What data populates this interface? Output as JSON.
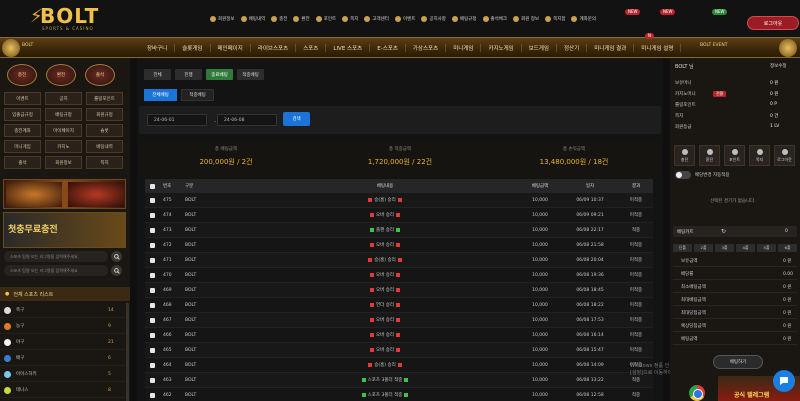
{
  "header": {
    "logo_text": "BOLT",
    "logo_sub": "SPORTS & CASINO",
    "menu": [
      {
        "icon": "user-icon",
        "label": "회원정보"
      },
      {
        "icon": "coin-icon",
        "label": "배팅내역"
      },
      {
        "icon": "deposit-icon",
        "label": "충전"
      },
      {
        "icon": "withdraw-icon",
        "label": "환전"
      },
      {
        "icon": "point-icon",
        "label": "포인트"
      },
      {
        "icon": "mail-icon",
        "label": "쪽지"
      },
      {
        "icon": "notice-icon",
        "label": "고객센터"
      },
      {
        "icon": "event-icon",
        "label": "이벤트"
      },
      {
        "icon": "rule-icon",
        "label": "공지사항"
      },
      {
        "icon": "bet-rule-icon",
        "label": "배팅규정"
      },
      {
        "icon": "attend-icon",
        "label": "출석체크"
      },
      {
        "icon": "gift-icon",
        "label": "회원 정보"
      },
      {
        "icon": "msg-icon",
        "label": "쪽지함"
      },
      {
        "icon": "account-icon",
        "label": "계좌문의"
      }
    ],
    "badges": [
      "NEW",
      "NEW",
      "NEW"
    ],
    "logout_label": "로그아웃"
  },
  "nav": {
    "left_tag": "BOLT",
    "right_tag": "BOLT EVENT",
    "items": [
      "장바구니",
      "슬롯게임",
      "메인페이지",
      "라이브스포츠",
      "스포츠",
      "LIVE 스포츠",
      "E-스포츠",
      "가상스포츠",
      "미니게임",
      "카지노게임",
      "보드게임",
      "정산기",
      "미니게임 결과",
      "미니게임 설명"
    ],
    "new_badge": "N"
  },
  "left": {
    "circles": [
      "충전",
      "환전",
      "출석"
    ],
    "grid": [
      "이벤트",
      "공지",
      "롤링포인트",
      "입출금규정",
      "배팅규정",
      "회원규정",
      "충전계좌",
      "마이페이지",
      "슬롯",
      "미니게임",
      "카지노",
      "베팅내역",
      "출석",
      "회원정보",
      "쪽지"
    ],
    "promo_text": "첫충무료충전",
    "inputs": [
      "스포츠 팀명 또는 리그명을 입력해주세요",
      "스포츠 팀명 또는 리그명을 입력해주세요"
    ],
    "sports_title": "전체 스포츠 리스트",
    "sports": [
      {
        "name": "축구",
        "count": "14",
        "color": "#dcdcdc"
      },
      {
        "name": "농구",
        "count": "9",
        "color": "#e07a2a"
      },
      {
        "name": "야구",
        "count": "21",
        "color": "#f2f2f2"
      },
      {
        "name": "배구",
        "count": "6",
        "color": "#3b7bd8"
      },
      {
        "name": "아이스하키",
        "count": "5",
        "color": "#7ac6f0"
      },
      {
        "name": "테니스",
        "count": "8",
        "color": "#c6dc3a"
      }
    ]
  },
  "main": {
    "tabs": [
      {
        "label": "전체",
        "active": false
      },
      {
        "label": "진행",
        "active": false
      },
      {
        "label": "종료베팅",
        "active": true
      },
      {
        "label": "적중베팅",
        "active": false
      }
    ],
    "subtabs": [
      {
        "label": "전체베팅",
        "active": true
      },
      {
        "label": "적중베팅",
        "active": false
      }
    ],
    "date_from": "24-06-01",
    "date_to": "24-06-08",
    "search_label": "검색",
    "summary": [
      {
        "label": "총 베팅금액",
        "value": "200,000원 / 2건"
      },
      {
        "label": "총 적중금액",
        "value": "1,720,000원 / 22건"
      },
      {
        "label": "총 손익금액",
        "value": "13,480,000원 / 18건"
      }
    ],
    "columns": [
      "번호",
      "구분",
      "베팅내용",
      "베팅금액",
      "일자",
      "결과"
    ],
    "rows": [
      {
        "no": "475",
        "type": "BOLT",
        "detail": "승(홈) 승리",
        "mark": "lose",
        "bet": "10,000",
        "date": "06/09 10:37",
        "res": "미적중"
      },
      {
        "no": "474",
        "type": "BOLT",
        "detail": "오버 승리",
        "mark": "lose",
        "bet": "10,000",
        "date": "06/09 09:21",
        "res": "미적중"
      },
      {
        "no": "473",
        "type": "BOLT",
        "detail": "플핸 승리",
        "mark": "win",
        "bet": "10,000",
        "date": "06/08 22:17",
        "res": "적중"
      },
      {
        "no": "472",
        "type": "BOLT",
        "detail": "오버 승리",
        "mark": "lose",
        "bet": "10,000",
        "date": "06/08 21:58",
        "res": "미적중"
      },
      {
        "no": "471",
        "type": "BOLT",
        "detail": "승(홈) 승리",
        "mark": "lose",
        "bet": "10,000",
        "date": "06/08 20:04",
        "res": "미적중"
      },
      {
        "no": "470",
        "type": "BOLT",
        "detail": "오버 승리",
        "mark": "lose",
        "bet": "10,000",
        "date": "06/08 19:36",
        "res": "미적중"
      },
      {
        "no": "469",
        "type": "BOLT",
        "detail": "오버 승리",
        "mark": "lose",
        "bet": "10,000",
        "date": "06/08 18:45",
        "res": "미적중"
      },
      {
        "no": "468",
        "type": "BOLT",
        "detail": "언더 승리",
        "mark": "lose",
        "bet": "10,000",
        "date": "06/08 18:22",
        "res": "미적중"
      },
      {
        "no": "467",
        "type": "BOLT",
        "detail": "오버 승리",
        "mark": "lose",
        "bet": "10,000",
        "date": "06/08 17:53",
        "res": "미적중"
      },
      {
        "no": "466",
        "type": "BOLT",
        "detail": "오버 승리",
        "mark": "lose",
        "bet": "10,000",
        "date": "06/08 16:14",
        "res": "미적중"
      },
      {
        "no": "465",
        "type": "BOLT",
        "detail": "오버 승리",
        "mark": "lose",
        "bet": "10,000",
        "date": "06/08 15:47",
        "res": "미적중"
      },
      {
        "no": "464",
        "type": "BOLT",
        "detail": "승(홈) 승리",
        "mark": "lose",
        "bet": "10,000",
        "date": "06/08 14:09",
        "res": "미적중"
      },
      {
        "no": "463",
        "type": "BOLT",
        "detail": "스포츠 3폴더 적중",
        "mark": "win",
        "bet": "10,000",
        "date": "06/08 13:22",
        "res": "적중"
      },
      {
        "no": "462",
        "type": "BOLT",
        "detail": "스포츠 3폴더 적중",
        "mark": "win",
        "bet": "10,000",
        "date": "06/08 12:58",
        "res": "적중"
      }
    ],
    "watermark_1": "Windows 정품 인증",
    "watermark_2": "[설정]으로 이동하여 Windows를 정품 인증합니다."
  },
  "right": {
    "user": "BOLT 님",
    "edit_label": "정보수정",
    "lines": [
      {
        "label": "보유머니",
        "value": "0 원",
        "tag": ""
      },
      {
        "label": "카지노머니",
        "value": "0 원",
        "tag": "전환"
      },
      {
        "label": "롤링포인트",
        "value": "0 P",
        "tag": ""
      },
      {
        "label": "쪽지",
        "value": "0 건",
        "tag": ""
      },
      {
        "label": "회원등급",
        "value": "1 LV",
        "tag": ""
      }
    ],
    "icons": [
      {
        "name": "deposit-icon",
        "label": "충전"
      },
      {
        "name": "withdraw-icon",
        "label": "환전"
      },
      {
        "name": "point-icon",
        "label": "포인트"
      },
      {
        "name": "mail-icon",
        "label": "쪽지"
      },
      {
        "name": "logout-icon",
        "label": "로그아웃"
      }
    ],
    "toggle_label": "배당변경 자동적용",
    "note": "선택된 경기가 없습니다.",
    "slip_label": "베팅카트",
    "slip_count": "0",
    "chips": [
      "단폴",
      "2폴",
      "3폴",
      "4폴",
      "5폴",
      "6폴"
    ],
    "list": [
      {
        "label": "보유금액",
        "value": "0 원"
      },
      {
        "label": "배당률",
        "value": "0.00"
      },
      {
        "label": "최소베팅금액",
        "value": "0 원"
      },
      {
        "label": "최대베팅금액",
        "value": "0 원"
      },
      {
        "label": "최대당첨금액",
        "value": "0 원"
      },
      {
        "label": "예상당첨금액",
        "value": "0 원"
      },
      {
        "label": "베팅금액",
        "value": "0 원"
      }
    ],
    "bet_button": "베팅하기",
    "ad_text": "공식 텔레그램"
  }
}
